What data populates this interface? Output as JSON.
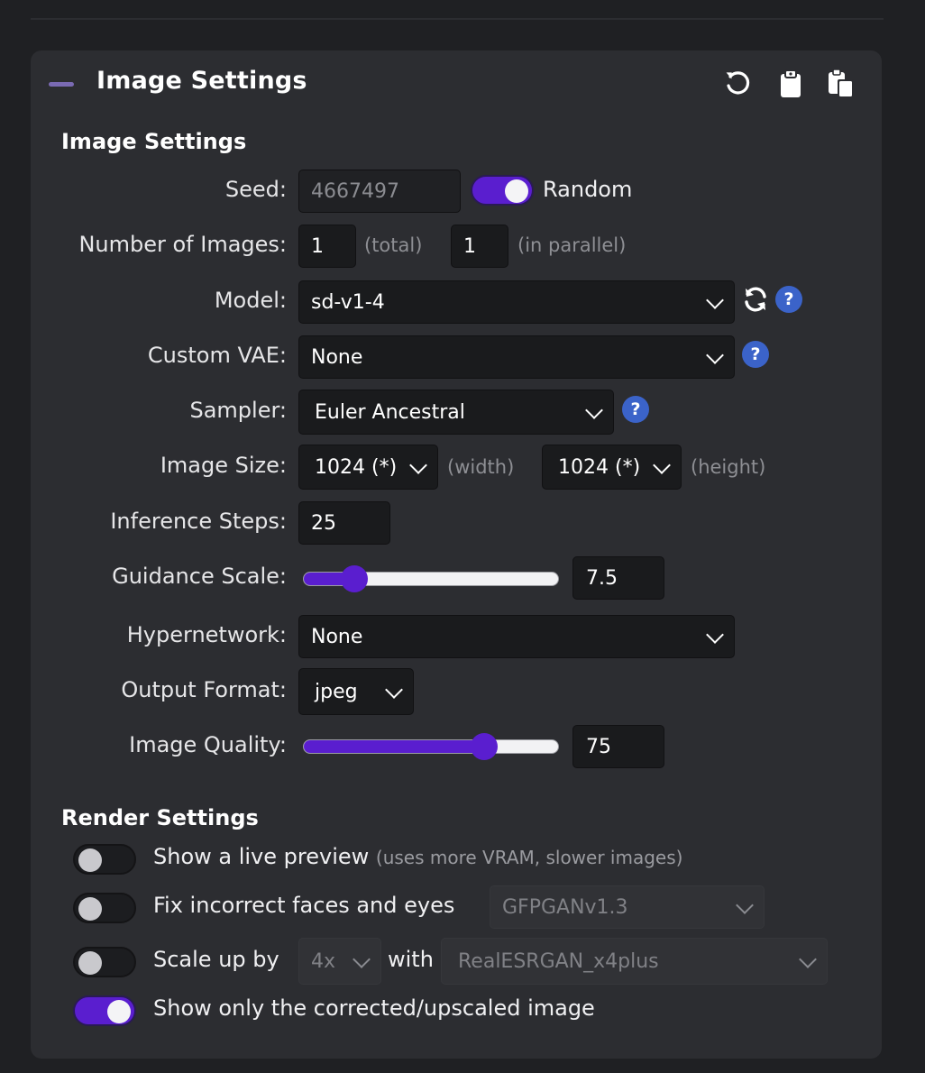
{
  "panel": {
    "title": "Image Settings"
  },
  "toolbar": {
    "icons": [
      "reset-icon",
      "clipboard-icon",
      "paste-icon"
    ]
  },
  "image_settings": {
    "section_title": "Image Settings",
    "seed": {
      "label": "Seed:",
      "value": "4667497",
      "random_label": "Random",
      "random_on": true
    },
    "num_images": {
      "label": "Number of Images:",
      "total": "1",
      "total_hint": "(total)",
      "parallel": "1",
      "parallel_hint": "(in parallel)"
    },
    "model": {
      "label": "Model:",
      "value": "sd-v1-4"
    },
    "vae": {
      "label": "Custom VAE:",
      "value": "None"
    },
    "sampler": {
      "label": "Sampler:",
      "value": "Euler Ancestral"
    },
    "image_size": {
      "label": "Image Size:",
      "width": "1024 (*)",
      "width_hint": "(width)",
      "height": "1024 (*)",
      "height_hint": "(height)"
    },
    "steps": {
      "label": "Inference Steps:",
      "value": "25"
    },
    "guidance": {
      "label": "Guidance Scale:",
      "value": "7.5",
      "slider_fraction": 0.2
    },
    "hypernetwork": {
      "label": "Hypernetwork:",
      "value": "None"
    },
    "output_format": {
      "label": "Output Format:",
      "value": "jpeg"
    },
    "quality": {
      "label": "Image Quality:",
      "value": "75",
      "slider_fraction": 0.71
    },
    "help_glyph": "?"
  },
  "render_settings": {
    "section_title": "Render Settings",
    "live_preview": {
      "label": "Show a live preview",
      "note": "(uses more VRAM, slower images)",
      "on": false
    },
    "fix_faces": {
      "label": "Fix incorrect faces and eyes",
      "model": "GFPGANv1.3",
      "on": false
    },
    "upscale": {
      "label": "Scale up by",
      "factor": "4x",
      "with_label": "with",
      "model": "RealESRGAN_x4plus",
      "on": false
    },
    "show_corrected": {
      "label": "Show only the corrected/upscaled image",
      "on": true
    }
  }
}
